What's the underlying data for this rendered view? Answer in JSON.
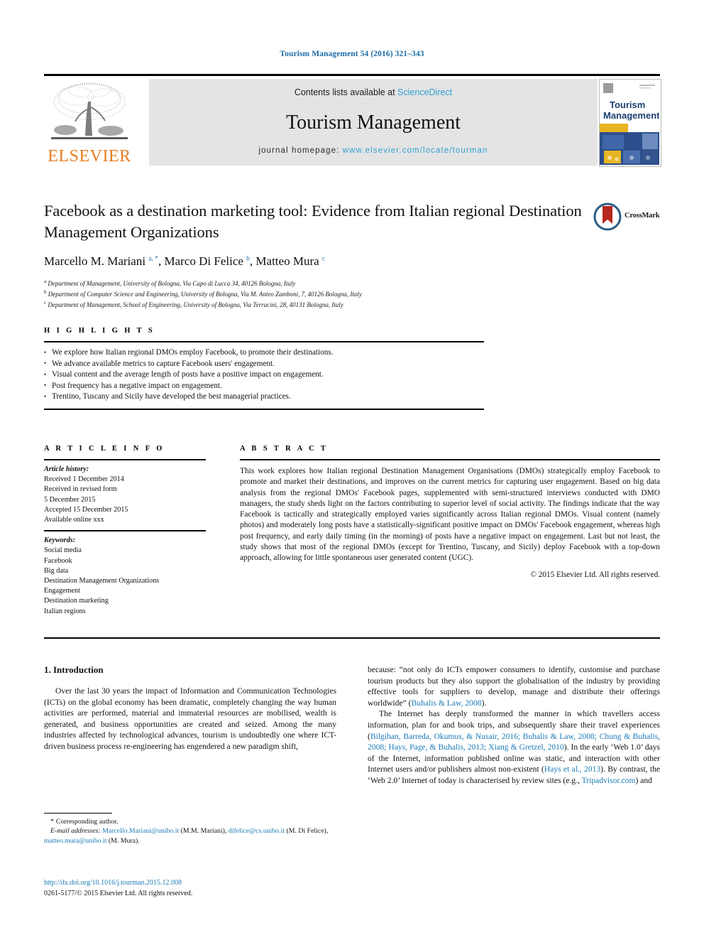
{
  "running_head": "Tourism Management 54 (2016) 321–343",
  "masthead": {
    "contents_prefix": "Contents lists available at ",
    "sciencedirect": "ScienceDirect",
    "journal_name": "Tourism Management",
    "homepage_prefix": "journal homepage: ",
    "homepage_url": "www.elsevier.com/locate/tourman",
    "publisher": "ELSEVIER",
    "cover_title_line1": "Tourism",
    "cover_title_line2": "Management",
    "link_color": "#2f9fd0",
    "publisher_color": "#e87b1e",
    "band_color": "#e4e4e4"
  },
  "article": {
    "title": "Facebook as a destination marketing tool: Evidence from Italian regional Destination Management Organizations",
    "authors_html": "Marcello M. Mariani <sup>a, *</sup>, Marco Di Felice <sup>b</sup>, Matteo Mura <sup>c</sup>",
    "affiliations": [
      {
        "marker": "a",
        "text": "Department of Management, University of Bologna, Via Capo di Lucca 34, 40126 Bologna, Italy"
      },
      {
        "marker": "b",
        "text": "Department of Computer Science and Engineering, University of Bologna, Via M. Anteo Zamboni, 7, 40126 Bologna, Italy"
      },
      {
        "marker": "c",
        "text": "Department of Management, School of Engineering, University of Bologna, Via Terracini, 28, 40131 Bologna, Italy"
      }
    ],
    "crossmark_label": "CrossMark"
  },
  "highlights": {
    "label": "H I G H L I G H T S",
    "items": [
      "We explore how Italian regional DMOs employ Facebook, to promote their destinations.",
      "We advance available metrics to capture Facebook users' engagement.",
      "Visual content and the average length of posts have a positive impact on engagement.",
      "Post frequency has a negative impact on engagement.",
      "Trentino, Tuscany and Sicily have developed the best managerial practices."
    ]
  },
  "article_info": {
    "label": "A R T I C L E   I N F O",
    "history_title": "Article history:",
    "history_lines": [
      "Received 1 December 2014",
      "Received in revised form",
      "5 December 2015",
      "Accepted 15 December 2015",
      "Available online xxx"
    ],
    "keywords_title": "Keywords:",
    "keywords": [
      "Social media",
      "Facebook",
      "Big data",
      "Destination Management Organizations",
      "Engagement",
      "Destination marketing",
      "Italian regions"
    ]
  },
  "abstract": {
    "label": "A B S T R A C T",
    "text": "This work explores how Italian regional Destination Management Organisations (DMOs) strategically employ Facebook to promote and market their destinations, and improves on the current metrics for capturing user engagement. Based on big data analysis from the regional DMOs' Facebook pages, supplemented with semi-structured interviews conducted with DMO managers, the study sheds light on the factors contributing to superior level of social activity. The findings indicate that the way Facebook is tactically and strategically employed varies significantly across Italian regional DMOs. Visual content (namely photos) and moderately long posts have a statistically-significant positive impact on DMOs' Facebook engagement, whereas high post frequency, and early daily timing (in the morning) of posts have a negative impact on engagement. Last but not least, the study shows that most of the regional DMOs (except for Trentino, Tuscany, and Sicily) deploy Facebook with a top-down approach, allowing for little spontaneous user generated content (UGC).",
    "copyright": "© 2015 Elsevier Ltd. All rights reserved."
  },
  "body": {
    "section_heading": "1. Introduction",
    "left_paragraph": "Over the last 30 years the impact of Information and Communication Technologies (ICTs) on the global economy has been dramatic, completely changing the way human activities are performed, material and immaterial resources are mobilised, wealth is generated, and business opportunities are created and seized. Among the many industries affected by technological advances, tourism is undoubtedly one where ICT-driven business process re-engineering has engendered a new paradigm shift,",
    "right_p1_pre": "because: “not only do ICTs empower consumers to identify, customise and purchase tourism products but they also support the globalisation of the industry by providing effective tools for suppliers to develop, manage and distribute their offerings worldwide” (",
    "right_p1_ref": "Buhalis & Law, 2008",
    "right_p1_post": ").",
    "right_p2_a": "The Internet has deeply transformed the manner in which travellers access information, plan for and book trips, and subsequently share their travel experiences (",
    "right_p2_ref1": "Bilgihan, Barreda, Okumus, & Nusair, 2016; Buhalis & Law, 2008; Chung & Buhalis, 2008; Hays, Page, & Buhalis, 2013; Xiang & Gretzel, 2010",
    "right_p2_b": "). In the early ‘Web 1.0’ days of the Internet, information published online was static, and interaction with other Internet users and/or publishers almost non-existent (",
    "right_p2_ref2": "Hays et al., 2013",
    "right_p2_c": "). By contrast, the ‘Web 2.0’ Internet of today is characterised by review sites (e.g., ",
    "right_p2_ref3": "Tripadvisor.com",
    "right_p2_d": ") and"
  },
  "footnote": {
    "corresponding_star": "*",
    "corresponding_text": "Corresponding author.",
    "email_label": "E-mail addresses:",
    "email1": "Marcello.Mariani@unibo.it",
    "email1_owner": " (M.M. Mariani), ",
    "email2": "difelice@cs.unibo.it",
    "email2_owner": " (M. Di Felice), ",
    "email3": "matteo.mura@unibo.it",
    "email3_owner": " (M. Mura)."
  },
  "doi": {
    "url": "http://dx.doi.org/10.1016/j.tourman.2015.12.008",
    "issn": "0261-5177/© 2015 Elsevier Ltd. All rights reserved."
  }
}
